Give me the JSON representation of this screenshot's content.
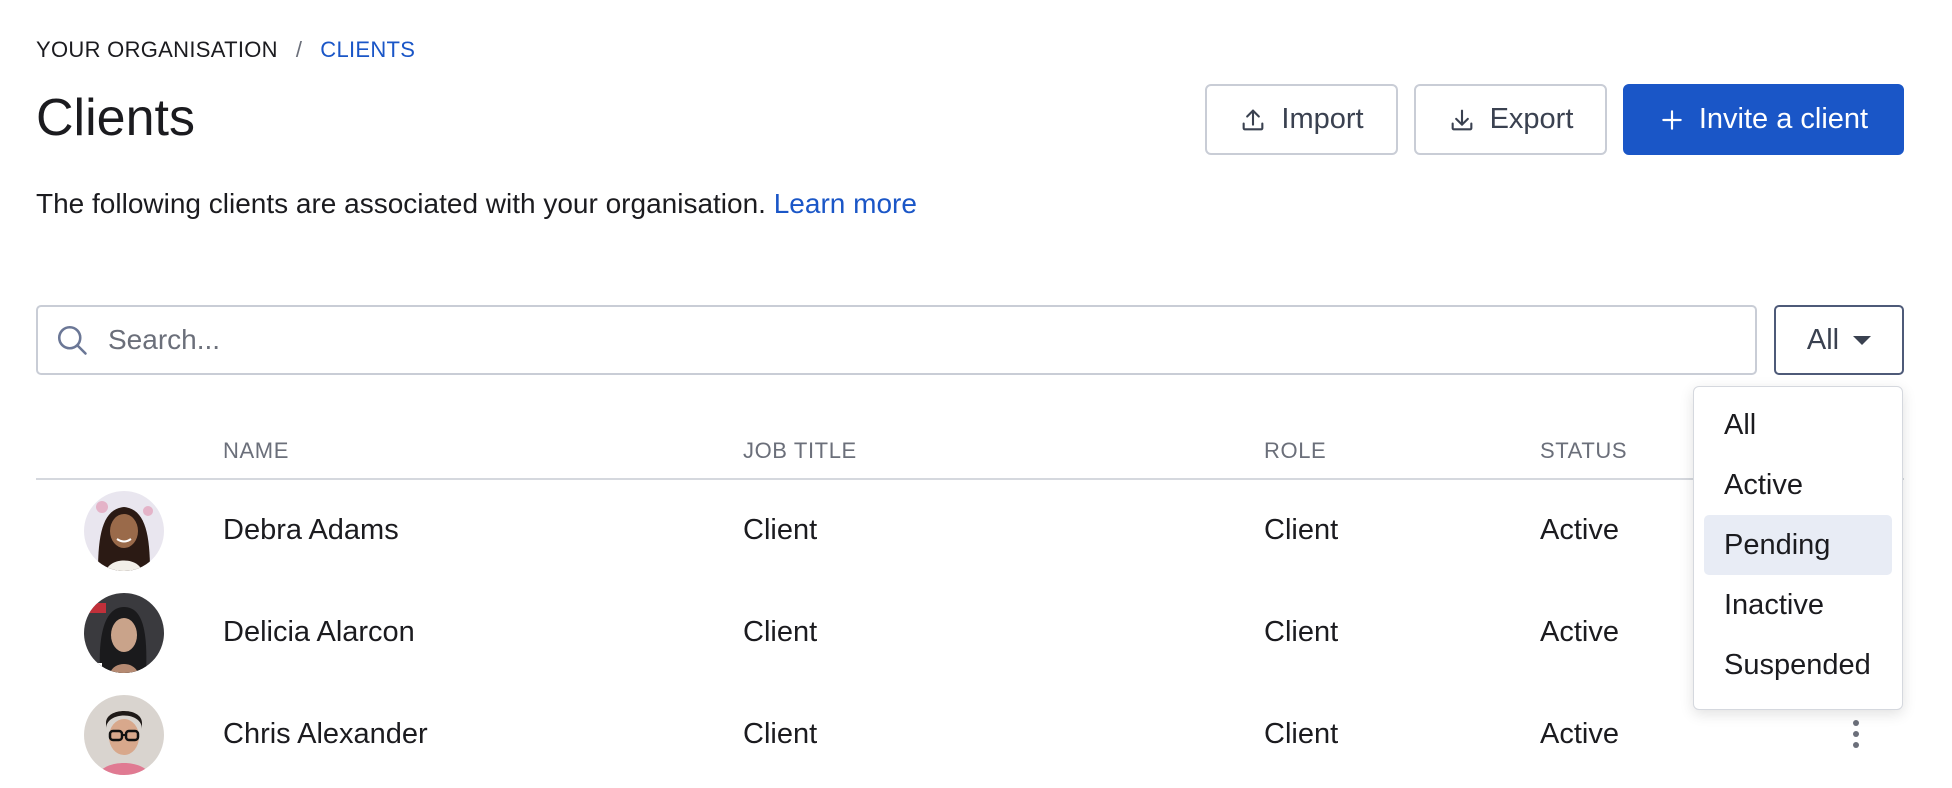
{
  "breadcrumb": {
    "root": "YOUR ORGANISATION",
    "separator": "/",
    "current": "CLIENTS"
  },
  "title": "Clients",
  "description": {
    "text": "The following clients are associated with your organisation.",
    "link": "Learn more"
  },
  "actions": {
    "import": "Import",
    "export": "Export",
    "invite": "Invite a client"
  },
  "search": {
    "placeholder": "Search...",
    "value": ""
  },
  "filter": {
    "selected": "All",
    "options": [
      "All",
      "Active",
      "Pending",
      "Inactive",
      "Suspended"
    ],
    "highlighted": "Pending"
  },
  "table": {
    "headers": {
      "name": "NAME",
      "job_title": "JOB TITLE",
      "role": "ROLE",
      "status": "STATUS"
    },
    "rows": [
      {
        "name": "Debra Adams",
        "job_title": "Client",
        "role": "Client",
        "status": "Active",
        "avatar_icon": "avatar-photo-icon"
      },
      {
        "name": "Delicia Alarcon",
        "job_title": "Client",
        "role": "Client",
        "status": "Active",
        "avatar_icon": "avatar-photo-icon"
      },
      {
        "name": "Chris Alexander",
        "job_title": "Client",
        "role": "Client",
        "status": "Active",
        "avatar_icon": "avatar-photo-icon"
      }
    ]
  },
  "colors": {
    "accent": "#1a56c7",
    "text": "#1b1b1f",
    "muted": "#6b6f7a",
    "border": "#c9cdd6",
    "highlight": "#e8ecf5"
  }
}
